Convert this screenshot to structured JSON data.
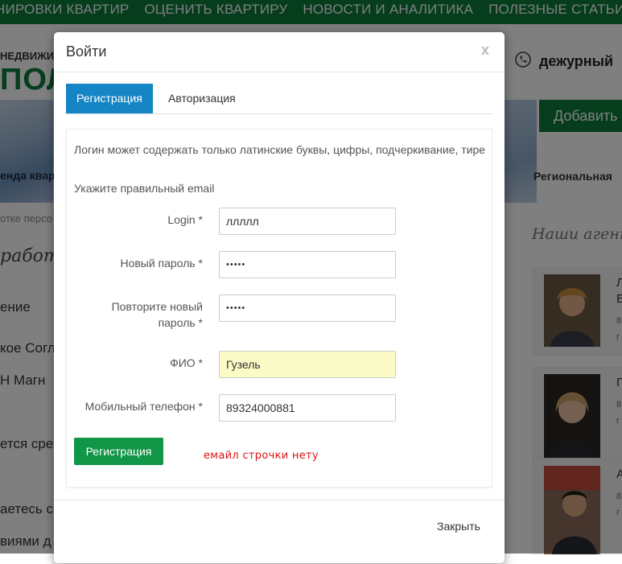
{
  "background": {
    "nav_items": [
      "НИРОВКИ КВАРТИР",
      "ОЦЕНИТЬ КВАРТИРУ",
      "НОВОСТИ И АНАЛИТИКА",
      "ПОЛЕЗНЫЕ СТАТЬИ"
    ],
    "logo_small": "НЕДВИЖИ",
    "logo_big": "ПОЛ",
    "phone_text": "дежурный",
    "add_button": "Добавить",
    "banner_caption": "енда квар",
    "regional": "Региональная",
    "small_gray": "отке персо",
    "italic_heading": "работ",
    "agents_heading": "Наши агент",
    "left_lines": [
      "ение",
      "кое Согла",
      "Н Магн",
      "ется сре",
      "аетесь с",
      "виями д"
    ],
    "agents": [
      {
        "name": "Л",
        "line2": "Е",
        "line3": "8",
        "line4": "г"
      },
      {
        "name": "Г",
        "line2": "8",
        "line3": "г",
        "line4": ""
      },
      {
        "name": "А",
        "line2": "8",
        "line3": "г",
        "line4": ""
      }
    ]
  },
  "modal": {
    "title": "Войти",
    "close_icon": "x",
    "tabs": [
      {
        "label": "Регистрация",
        "active": true
      },
      {
        "label": "Авторизация",
        "active": false
      }
    ],
    "messages": [
      "Логин может содержать только латинские буквы, цифры, подчеркивание, тире",
      "Укажите правильный email"
    ],
    "fields": {
      "login": {
        "label": "Login *",
        "value": "ллллл"
      },
      "new_password": {
        "label": "Новый пароль *",
        "value": "•••••"
      },
      "repeat_password": {
        "label": "Повторите новый пароль *",
        "value": "•••••"
      },
      "fio": {
        "label": "ФИО *",
        "value": "Гузель"
      },
      "phone": {
        "label": "Мобильный телефон *",
        "value": "89324000881"
      }
    },
    "submit_label": "Регистрация",
    "annotation": "емайл строчки нету",
    "footer_close": "Закрыть"
  },
  "colors": {
    "brand_green": "#0b7a3a",
    "tab_blue": "#1585c5",
    "button_green": "#119547",
    "annotation_red": "#dd1111",
    "autofill_yellow": "#fbfbc8"
  }
}
